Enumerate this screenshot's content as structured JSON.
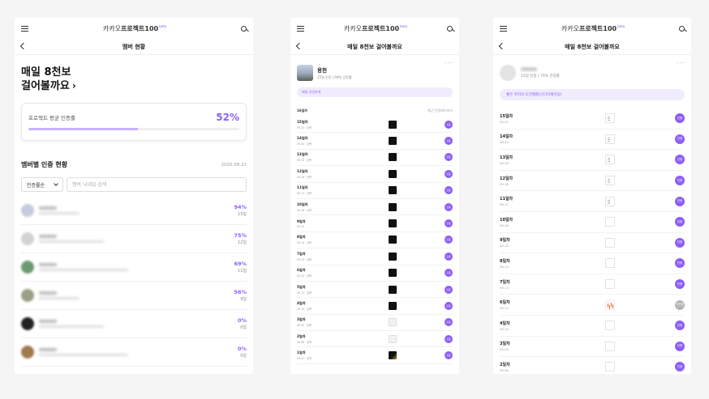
{
  "brand": {
    "prefix": "카카오",
    "name": "프로젝트100",
    "badge": "beta"
  },
  "screen1": {
    "title": "멤버 현황",
    "hero": {
      "line1": "매일 8천보",
      "line2": "걸어볼까요",
      "arrow": "›"
    },
    "rate": {
      "label": "프로젝트 평균 인증률",
      "value": "52%",
      "fraction": 0.52
    },
    "section": {
      "title": "멤버별 인증 현황",
      "date": "2020.09.22"
    },
    "filter": {
      "selected": "인증률순",
      "placeholder": "멤버 닉네임 검색"
    },
    "members": [
      {
        "percent": "94%",
        "count": "15일",
        "avatar": "#c5cbe0"
      },
      {
        "percent": "75%",
        "count": "12일",
        "avatar": "#d2d2d2"
      },
      {
        "percent": "69%",
        "count": "11일",
        "avatar": "#6c9a72"
      },
      {
        "percent": "56%",
        "count": "9일",
        "avatar": "#9c9f86"
      },
      {
        "percent": "0%",
        "count": "0일",
        "avatar": "#222222"
      },
      {
        "percent": "0%",
        "count": "0일",
        "avatar": "#a07a4d"
      }
    ]
  },
  "screen2": {
    "title": "매일 8천보 걸어볼까요",
    "profile": {
      "name": "용현",
      "stats": "15일 인증 | 94% 인증률",
      "more": "···"
    },
    "pill": "매일 무엇하게",
    "list_header": "16일차",
    "list_link": "최근 인증피드보기",
    "button_label": "인증",
    "rows": [
      {
        "day": "15일차",
        "date": "09.21 · 금목",
        "thumb": "dark"
      },
      {
        "day": "14일차",
        "date": "09.20 · 금목",
        "thumb": "dark"
      },
      {
        "day": "13일차",
        "date": "09.19 · 금목",
        "thumb": "dark"
      },
      {
        "day": "12일차",
        "date": "09.18 · 금목",
        "thumb": "dark"
      },
      {
        "day": "11일차",
        "date": "09.17 · 금목",
        "thumb": "dark"
      },
      {
        "day": "10일차",
        "date": "09.16 · 금목",
        "thumb": "dark"
      },
      {
        "day": "9일차",
        "date": "09.15",
        "thumb": "dark"
      },
      {
        "day": "8일차",
        "date": "09.14 · 금목",
        "thumb": "dark"
      },
      {
        "day": "7일차",
        "date": "09.13 · 금목",
        "thumb": "dark"
      },
      {
        "day": "6일차",
        "date": "09.12 · 금목",
        "thumb": "dark"
      },
      {
        "day": "5일차",
        "date": "09.11 · 금목",
        "thumb": "dark"
      },
      {
        "day": "4일차",
        "date": "09.10 · 금목",
        "thumb": "dark"
      },
      {
        "day": "3일차",
        "date": "09.09 · 금목",
        "thumb": "light"
      },
      {
        "day": "2일차",
        "date": "09.08 · 금목",
        "thumb": "light"
      },
      {
        "day": "1일차",
        "date": "09.07 · 금목",
        "thumb": "gold"
      }
    ]
  },
  "screen3": {
    "title": "매일 8천보 걸어볼까요",
    "profile": {
      "stats": "12일 인증 | 75% 인증률",
      "more": "···"
    },
    "pill": "좋은 취지의 도전배틀(나다이페이팅)",
    "button_label": "인증",
    "missed_label": "미인증",
    "rows": [
      {
        "day": "15일차",
        "date": "09.21",
        "thumb": "lines",
        "status": "done"
      },
      {
        "day": "14일차",
        "date": "09.20",
        "thumb": "lines",
        "status": "done"
      },
      {
        "day": "13일차",
        "date": "09.19",
        "thumb": "lines",
        "status": "done"
      },
      {
        "day": "12일차",
        "date": "09.18",
        "thumb": "lines",
        "status": "done"
      },
      {
        "day": "11일차",
        "date": "09.17",
        "thumb": "lines",
        "status": "done"
      },
      {
        "day": "10일차",
        "date": "09.16",
        "thumb": "blank",
        "status": "done"
      },
      {
        "day": "9일차",
        "date": "09.15",
        "thumb": "blank",
        "status": "done"
      },
      {
        "day": "8일차",
        "date": "09.14",
        "thumb": "blank",
        "status": "done"
      },
      {
        "day": "7일차",
        "date": "09.13",
        "thumb": "blank",
        "status": "done"
      },
      {
        "day": "6일차",
        "date": "09.12",
        "thumb": "chart",
        "status": "missed"
      },
      {
        "day": "4일차",
        "date": "09.10",
        "thumb": "blank",
        "status": "done"
      },
      {
        "day": "3일차",
        "date": "09.09",
        "thumb": "blank",
        "status": "done"
      },
      {
        "day": "2일차",
        "date": "09.08",
        "thumb": "blank",
        "status": "done"
      }
    ]
  },
  "colors": {
    "accent": "#8c5ff5",
    "accent_light": "#f1ecfd",
    "muted": "#b5b5b5"
  },
  "icons": {
    "menu": "hamburger-icon",
    "search": "search-icon",
    "back": "back-arrow-icon",
    "more": "more-icon"
  }
}
